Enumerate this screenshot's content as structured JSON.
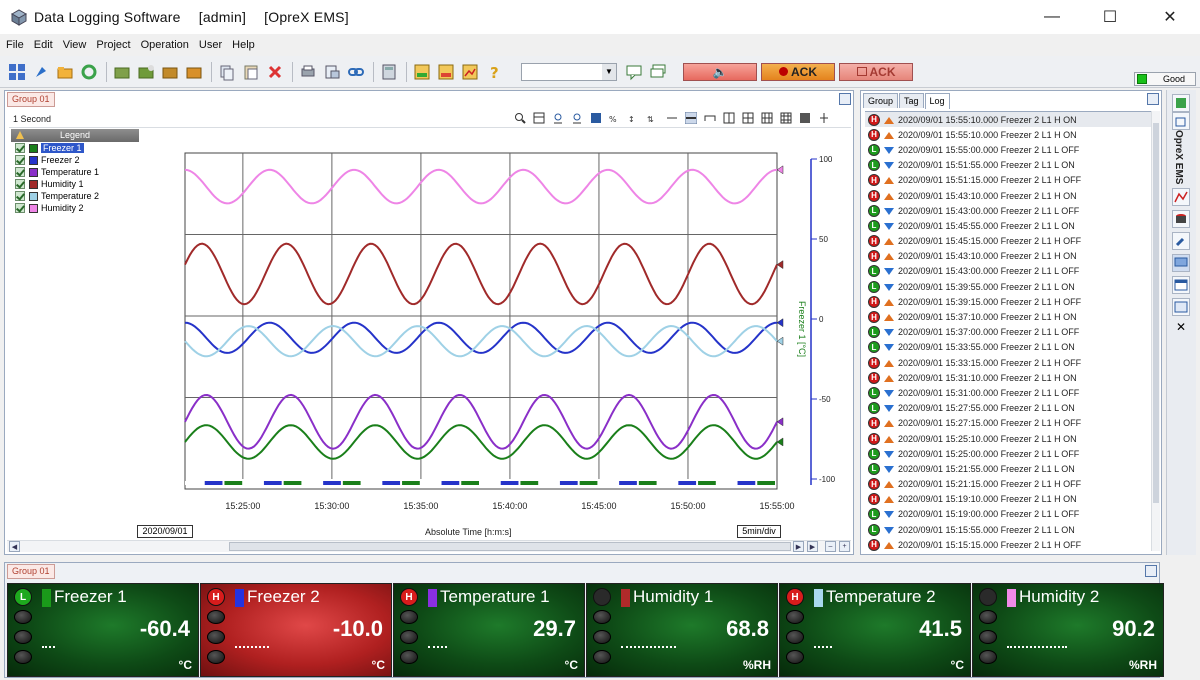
{
  "window": {
    "app_name": "Data Logging Software",
    "user": "[admin]",
    "product": "[OpreX EMS]",
    "controls": [
      "—",
      "☐",
      "✕"
    ]
  },
  "menu": [
    "File",
    "Edit",
    "View",
    "Project",
    "Operation",
    "User",
    "Help"
  ],
  "toolbar": {
    "ack_label": "ACK",
    "lack_label": "ACK",
    "status": "Good"
  },
  "chart_panel": {
    "tab": "Group 01",
    "interval": "1 Second",
    "legend_title": "Legend",
    "date_label": "2020/09/01",
    "axis_title": "Absolute Time [h:m:s]",
    "div_label": "5min/div",
    "y_axis_label": "Freezer 1 [°C]"
  },
  "chart_data": {
    "type": "line",
    "x_ticks": [
      "15:25:00",
      "15:30:00",
      "15:35:00",
      "15:40:00",
      "15:45:00",
      "15:50:00",
      "15:55:00"
    ],
    "y_ticks": [
      "100",
      "50",
      "0",
      "-50",
      "-100"
    ],
    "ylim": [
      -100,
      100
    ],
    "grid": true,
    "legend_position": "top-left",
    "series": [
      {
        "name": "Freezer 1",
        "color": "#1a7f1a",
        "style": "band",
        "center": -72,
        "amplitude": 10,
        "periods": 7,
        "phase": 0.0
      },
      {
        "name": "Freezer 2",
        "color": "#2533c9",
        "style": "band",
        "center": -10,
        "amplitude": 9,
        "periods": 7,
        "phase": 0.25
      },
      {
        "name": "Temperature 1",
        "color": "#8a2fc8",
        "style": "band",
        "center": -60,
        "amplitude": 16,
        "periods": 7,
        "phase": 0.0
      },
      {
        "name": "Humidity 1",
        "color": "#a02a2a",
        "style": "band",
        "center": 28,
        "amplitude": 18,
        "periods": 7,
        "phase": 0.05
      },
      {
        "name": "Temperature 2",
        "color": "#9fd1e6",
        "style": "band",
        "center": -12,
        "amplitude": 9,
        "periods": 7,
        "phase": 0.5
      },
      {
        "name": "Humidity 2",
        "color": "#ee85e6",
        "style": "band",
        "center": 80,
        "amplitude": 10,
        "periods": 7,
        "phase": 0.25
      }
    ]
  },
  "log_panel": {
    "tabs": [
      "Group",
      "Tag",
      "Log"
    ],
    "rows": [
      {
        "s": "H",
        "d": "up",
        "text": "2020/09/01 15:55:10.000 Freezer 2 L1 H ON"
      },
      {
        "s": "H",
        "d": "up",
        "text": "2020/09/01 15:55:10.000 Freezer 2 L1 H ON"
      },
      {
        "s": "L",
        "d": "down",
        "text": "2020/09/01 15:55:00.000 Freezer 2 L1 L OFF"
      },
      {
        "s": "L",
        "d": "down",
        "text": "2020/09/01 15:51:55.000 Freezer 2 L1 L ON"
      },
      {
        "s": "H",
        "d": "up",
        "text": "2020/09/01 15:51:15.000 Freezer 2 L1 H OFF"
      },
      {
        "s": "H",
        "d": "up",
        "text": "2020/09/01 15:43:10.000 Freezer 2 L1 H ON"
      },
      {
        "s": "L",
        "d": "down",
        "text": "2020/09/01 15:43:00.000 Freezer 2 L1 L OFF"
      },
      {
        "s": "L",
        "d": "down",
        "text": "2020/09/01 15:45:55.000 Freezer 2 L1 L ON"
      },
      {
        "s": "H",
        "d": "up",
        "text": "2020/09/01 15:45:15.000 Freezer 2 L1 H OFF"
      },
      {
        "s": "H",
        "d": "up",
        "text": "2020/09/01 15:43:10.000 Freezer 2 L1 H ON"
      },
      {
        "s": "L",
        "d": "down",
        "text": "2020/09/01 15:43:00.000 Freezer 2 L1 L OFF"
      },
      {
        "s": "L",
        "d": "down",
        "text": "2020/09/01 15:39:55.000 Freezer 2 L1 L ON"
      },
      {
        "s": "H",
        "d": "up",
        "text": "2020/09/01 15:39:15.000 Freezer 2 L1 H OFF"
      },
      {
        "s": "H",
        "d": "up",
        "text": "2020/09/01 15:37:10.000 Freezer 2 L1 H ON"
      },
      {
        "s": "L",
        "d": "down",
        "text": "2020/09/01 15:37:00.000 Freezer 2 L1 L OFF"
      },
      {
        "s": "L",
        "d": "down",
        "text": "2020/09/01 15:33:55.000 Freezer 2 L1 L ON"
      },
      {
        "s": "H",
        "d": "up",
        "text": "2020/09/01 15:33:15.000 Freezer 2 L1 H OFF"
      },
      {
        "s": "H",
        "d": "up",
        "text": "2020/09/01 15:31:10.000 Freezer 2 L1 H ON"
      },
      {
        "s": "L",
        "d": "down",
        "text": "2020/09/01 15:31:00.000 Freezer 2 L1 L OFF"
      },
      {
        "s": "L",
        "d": "down",
        "text": "2020/09/01 15:27:55.000 Freezer 2 L1 L ON"
      },
      {
        "s": "H",
        "d": "up",
        "text": "2020/09/01 15:27:15.000 Freezer 2 L1 H OFF"
      },
      {
        "s": "H",
        "d": "up",
        "text": "2020/09/01 15:25:10.000 Freezer 2 L1 H ON"
      },
      {
        "s": "L",
        "d": "down",
        "text": "2020/09/01 15:25:00.000 Freezer 2 L1 L OFF"
      },
      {
        "s": "L",
        "d": "down",
        "text": "2020/09/01 15:21:55.000 Freezer 2 L1 L ON"
      },
      {
        "s": "H",
        "d": "up",
        "text": "2020/09/01 15:21:15.000 Freezer 2 L1 H OFF"
      },
      {
        "s": "H",
        "d": "up",
        "text": "2020/09/01 15:19:10.000 Freezer 2 L1 H ON"
      },
      {
        "s": "L",
        "d": "down",
        "text": "2020/09/01 15:19:00.000 Freezer 2 L1 L OFF"
      },
      {
        "s": "L",
        "d": "down",
        "text": "2020/09/01 15:15:55.000 Freezer 2 L1 L ON"
      },
      {
        "s": "H",
        "d": "up",
        "text": "2020/09/01 15:15:15.000 Freezer 2 L1 H OFF"
      }
    ]
  },
  "sidebar": {
    "label": "OpreX EMS"
  },
  "bottom_panel": {
    "tab": "Group 01",
    "tiles": [
      {
        "name": "Freezer 1",
        "status": "L",
        "color": "#1a9a1a",
        "value": "-60.4",
        "unit": "°C",
        "alarm": false,
        "level": 0.18
      },
      {
        "name": "Freezer 2",
        "status": "H",
        "color": "#2533e0",
        "value": "-10.0",
        "unit": "°C",
        "alarm": true,
        "level": 0.49
      },
      {
        "name": "Temperature 1",
        "status": "H",
        "color": "#8a2fe0",
        "value": "29.7",
        "unit": "°C",
        "alarm": false,
        "level": 0.27
      },
      {
        "name": "Humidity 1",
        "status": "",
        "color": "#b02a2a",
        "value": "68.8",
        "unit": "%RH",
        "alarm": false,
        "level": 0.78
      },
      {
        "name": "Temperature 2",
        "status": "H",
        "color": "#a9d8ee",
        "value": "41.5",
        "unit": "°C",
        "alarm": false,
        "level": 0.26
      },
      {
        "name": "Humidity 2",
        "status": "",
        "color": "#f08ae8",
        "value": "90.2",
        "unit": "%RH",
        "alarm": false,
        "level": 0.86
      }
    ]
  }
}
